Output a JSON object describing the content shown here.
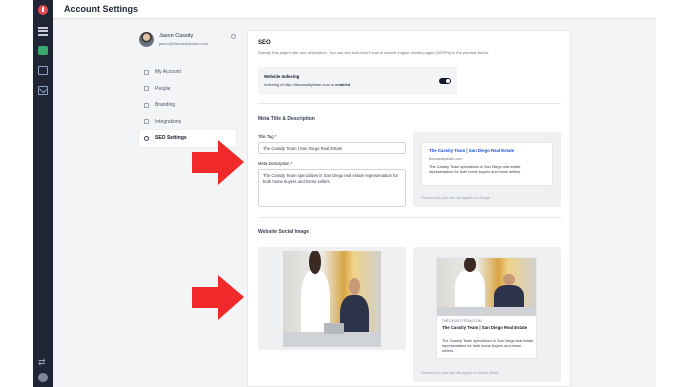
{
  "header": {
    "title": "Account Settings"
  },
  "profile": {
    "name": "Jason Cassity",
    "email": "jason@thecassityteam.com"
  },
  "nav": {
    "items": [
      {
        "label": "My Account",
        "icon": "user-circle-icon"
      },
      {
        "label": "People",
        "icon": "people-icon"
      },
      {
        "label": "Branding",
        "icon": "window-icon"
      },
      {
        "label": "Integrations",
        "icon": "heart-icon"
      },
      {
        "label": "SEO Settings",
        "icon": "globe-icon",
        "active": true
      }
    ]
  },
  "seo": {
    "heading": "SEO",
    "description": "Specify this page's title and description. You can see how they'll look in search engine results pages (SERPs) in the preview below.",
    "indexing": {
      "title": "Website Indexing",
      "status_prefix": "Indexing of http://thecassityteam.com is ",
      "status_value": "enabled",
      "enabled": true
    },
    "meta": {
      "heading": "Meta Title & Description",
      "title_label": "Title Tag *",
      "title_value": "The Cassity Team | San Diego Real Estate",
      "description_label": "Meta Description *",
      "description_value": "The Cassity Team specializes in San Diego real estate representation for both home buyers and home sellers."
    },
    "google_preview": {
      "title": "The Cassity Team | San Diego Real Estate",
      "url": "thecassityteam.com",
      "description": "The Cassity Team specializes in San Diego real estate representation for both home buyers and home sellers.",
      "hint": "Preview how your site will appear on Google"
    },
    "social": {
      "heading": "Website Social Image",
      "domain": "THECASSITYTEAM.COM",
      "title": "The Cassity Team | San Diego Real Estate",
      "description": "The Cassity Team specializes in San Diego real estate representation for both home buyers and home sellers.",
      "hint": "Preview how your site will appear on Social Media"
    }
  },
  "colors": {
    "rail": "#1f2535",
    "accent_red": "#f02a2a",
    "link_blue": "#1d4ed8"
  }
}
